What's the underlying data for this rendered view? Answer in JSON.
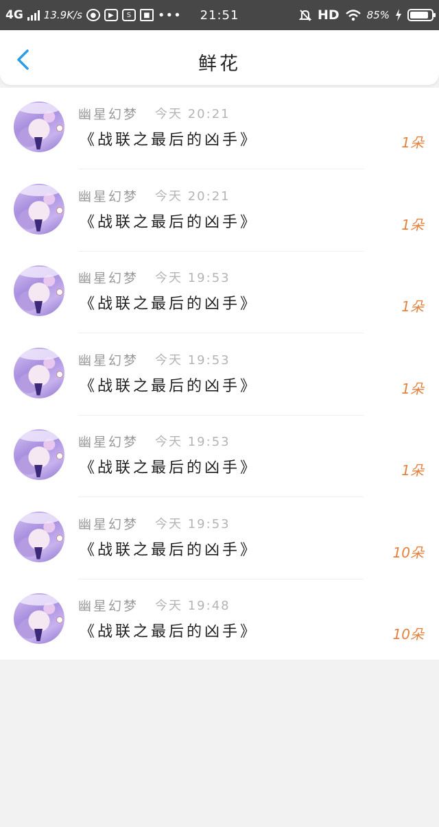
{
  "status_bar": {
    "network": "4G",
    "speed": "13.9K/s",
    "time": "21:51",
    "hd": "HD",
    "battery": "85%",
    "battery_level": 0.85
  },
  "header": {
    "title": "鲜花"
  },
  "colors": {
    "accent": "#2a9ce8",
    "count_orange": "#e5813d"
  },
  "records": [
    {
      "user": "幽星幻梦",
      "time": "今天 20:21",
      "book": "《战联之最后的凶手》",
      "count": "1朵"
    },
    {
      "user": "幽星幻梦",
      "time": "今天 20:21",
      "book": "《战联之最后的凶手》",
      "count": "1朵"
    },
    {
      "user": "幽星幻梦",
      "time": "今天 19:53",
      "book": "《战联之最后的凶手》",
      "count": "1朵"
    },
    {
      "user": "幽星幻梦",
      "time": "今天 19:53",
      "book": "《战联之最后的凶手》",
      "count": "1朵"
    },
    {
      "user": "幽星幻梦",
      "time": "今天 19:53",
      "book": "《战联之最后的凶手》",
      "count": "1朵"
    },
    {
      "user": "幽星幻梦",
      "time": "今天 19:53",
      "book": "《战联之最后的凶手》",
      "count": "10朵"
    },
    {
      "user": "幽星幻梦",
      "time": "今天 19:48",
      "book": "《战联之最后的凶手》",
      "count": "10朵"
    }
  ]
}
